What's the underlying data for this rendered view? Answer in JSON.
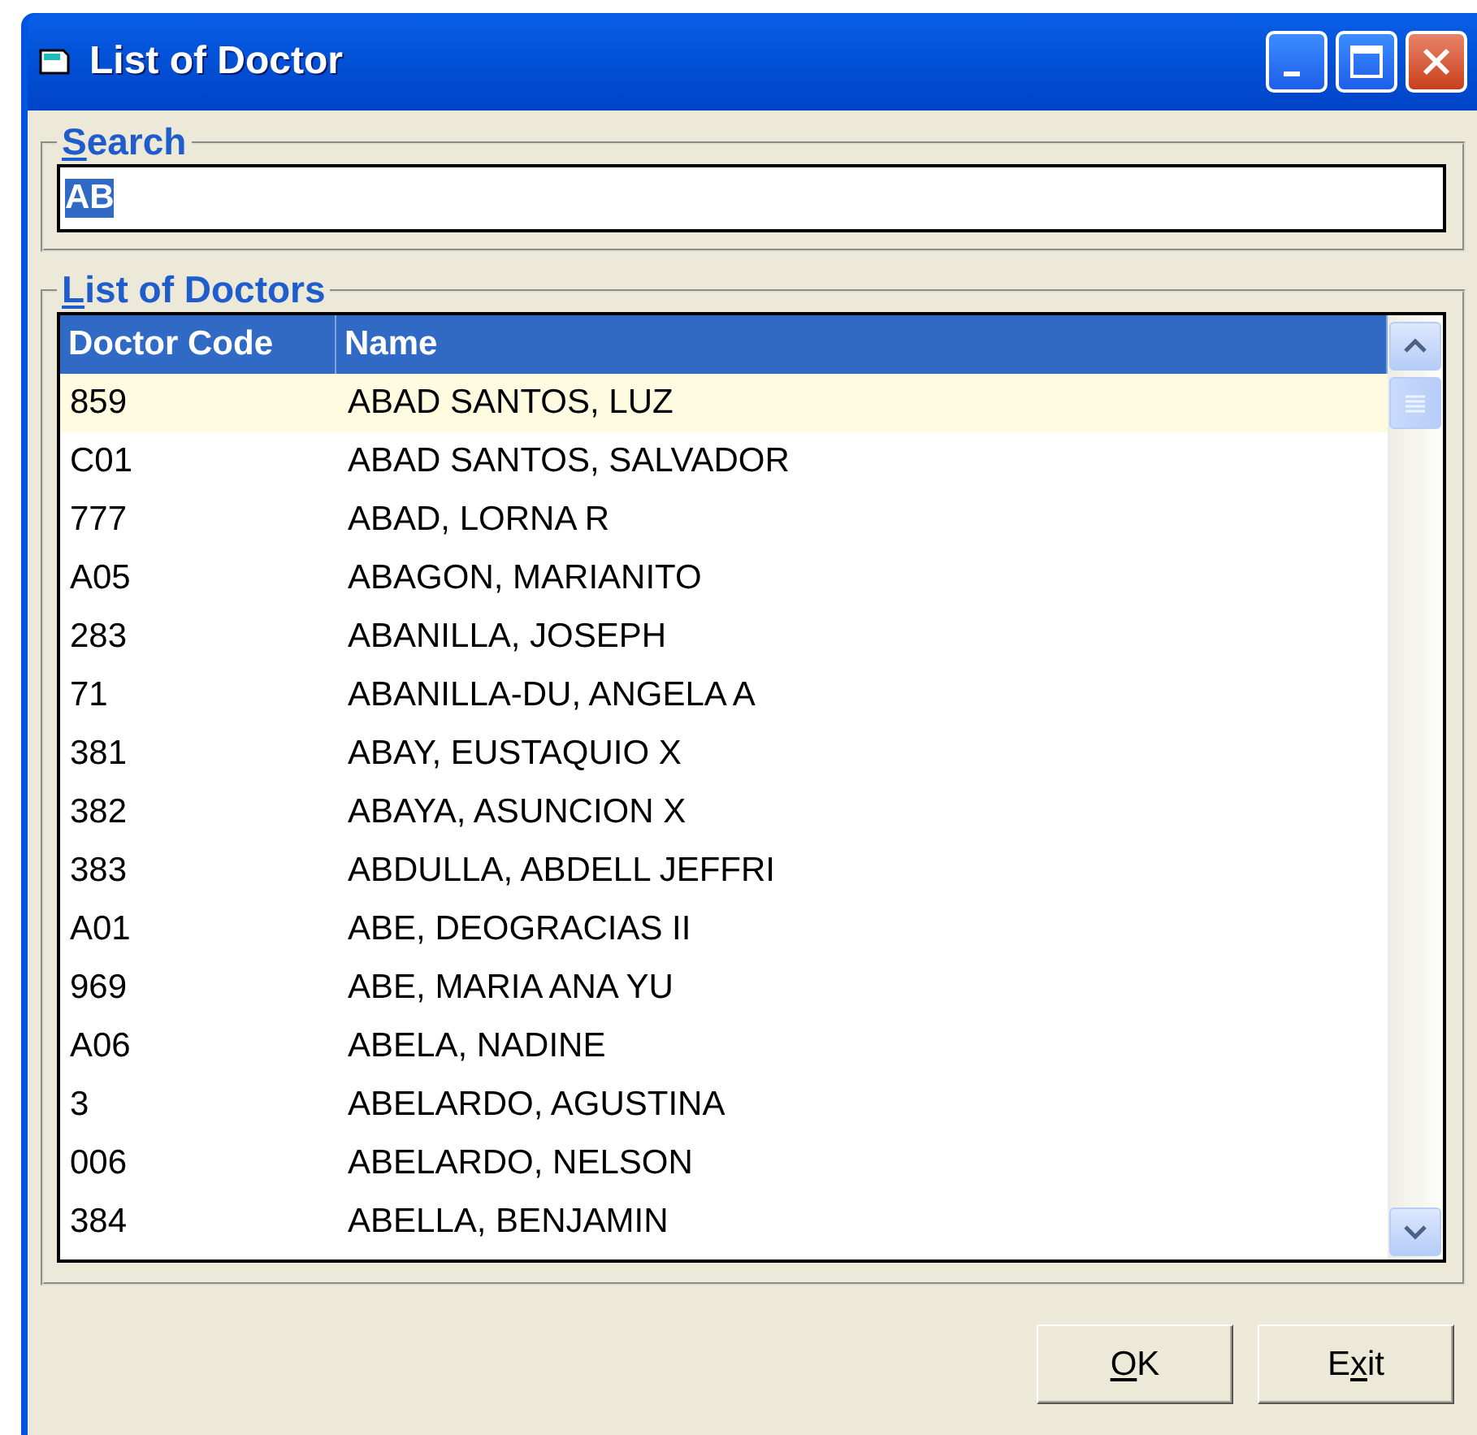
{
  "window": {
    "title": "List of Doctor"
  },
  "search": {
    "label": [
      {
        "text": "S",
        "underlined": true
      },
      {
        "text": "earch",
        "underlined": false
      }
    ],
    "value": "AB",
    "text_selected": true
  },
  "list": {
    "label": [
      {
        "text": "L",
        "underlined": true
      },
      {
        "text": "ist of Doctors",
        "underlined": false
      }
    ],
    "columns": [
      "Doctor Code",
      "Name"
    ],
    "rows": [
      {
        "code": "859",
        "name": "ABAD SANTOS, LUZ",
        "selected": true
      },
      {
        "code": "C01",
        "name": "ABAD SANTOS, SALVADOR",
        "selected": false
      },
      {
        "code": "777",
        "name": "ABAD, LORNA R",
        "selected": false
      },
      {
        "code": "A05",
        "name": "ABAGON, MARIANITO",
        "selected": false
      },
      {
        "code": "283",
        "name": "ABANILLA, JOSEPH",
        "selected": false
      },
      {
        "code": "71",
        "name": "ABANILLA-DU, ANGELA A",
        "selected": false
      },
      {
        "code": "381",
        "name": "ABAY, EUSTAQUIO X",
        "selected": false
      },
      {
        "code": "382",
        "name": "ABAYA, ASUNCION X",
        "selected": false
      },
      {
        "code": "383",
        "name": "ABDULLA, ABDELL JEFFRI",
        "selected": false
      },
      {
        "code": "A01",
        "name": "ABE, DEOGRACIAS II",
        "selected": false
      },
      {
        "code": "969",
        "name": "ABE, MARIA ANA YU",
        "selected": false
      },
      {
        "code": "A06",
        "name": "ABELA, NADINE",
        "selected": false
      },
      {
        "code": "3",
        "name": "ABELARDO, AGUSTINA",
        "selected": false
      },
      {
        "code": "006",
        "name": "ABELARDO, NELSON",
        "selected": false
      },
      {
        "code": "384",
        "name": "ABELLA, BENJAMIN",
        "selected": false
      }
    ]
  },
  "buttons": [
    {
      "label": [
        {
          "text": "O",
          "underlined": true
        },
        {
          "text": "K",
          "underlined": false
        }
      ]
    },
    {
      "label": [
        {
          "text": "E",
          "underlined": false
        },
        {
          "text": "x",
          "underlined": true
        },
        {
          "text": "it",
          "underlined": false
        }
      ]
    }
  ]
}
